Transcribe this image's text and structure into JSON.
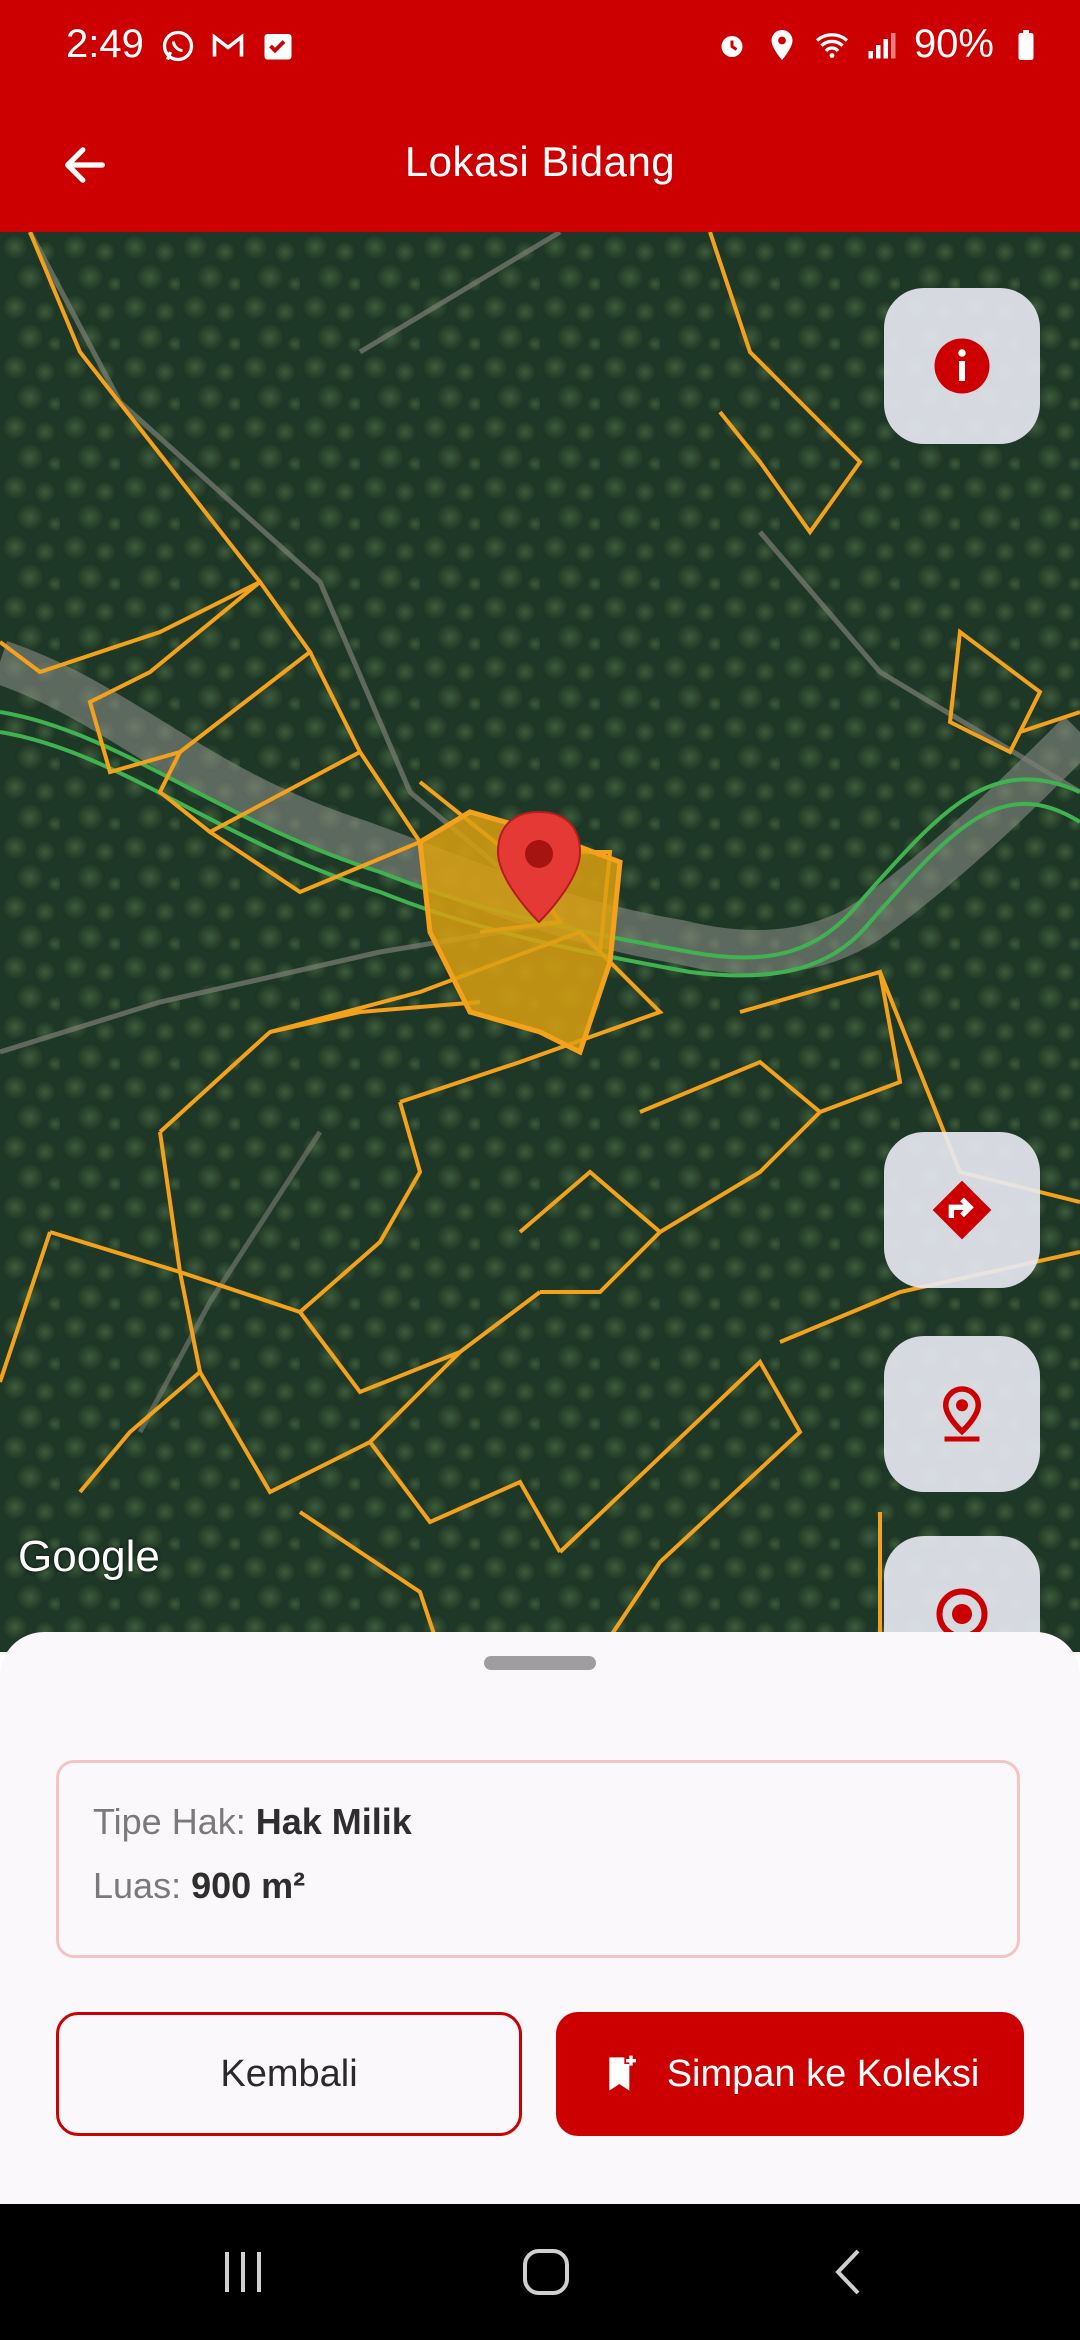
{
  "status_bar": {
    "time": "2:49",
    "battery": "90%",
    "left_icons": [
      "whatsapp-icon",
      "gmail-icon",
      "task-check-icon"
    ],
    "right_icons": [
      "alarm-icon",
      "location-icon",
      "wifi-icon",
      "signal-icon",
      "battery-icon"
    ]
  },
  "app_bar": {
    "title": "Lokasi Bidang",
    "back_icon": "arrow-left-icon"
  },
  "map": {
    "provider_logo": "Google",
    "buttons": [
      {
        "name": "info",
        "icon": "info-icon"
      },
      {
        "name": "directions",
        "icon": "directions-icon"
      },
      {
        "name": "pin-location",
        "icon": "pin-location-icon"
      },
      {
        "name": "my-location",
        "icon": "target-icon"
      }
    ],
    "colors": {
      "parcel_outline": "#f4a21b",
      "selected_parcel_fill": "#d9a010",
      "road_line": "#3fb34f",
      "marker": "#e53935"
    }
  },
  "info": {
    "tipe_label": "Tipe Hak: ",
    "tipe_value": "Hak Milik",
    "luas_label": "Luas: ",
    "luas_value": "900 m²"
  },
  "actions": {
    "back_label": "Kembali",
    "save_label": "Simpan ke Koleksi",
    "save_icon": "bookmark-add-icon"
  },
  "theme": {
    "primary": "#cc0000"
  }
}
